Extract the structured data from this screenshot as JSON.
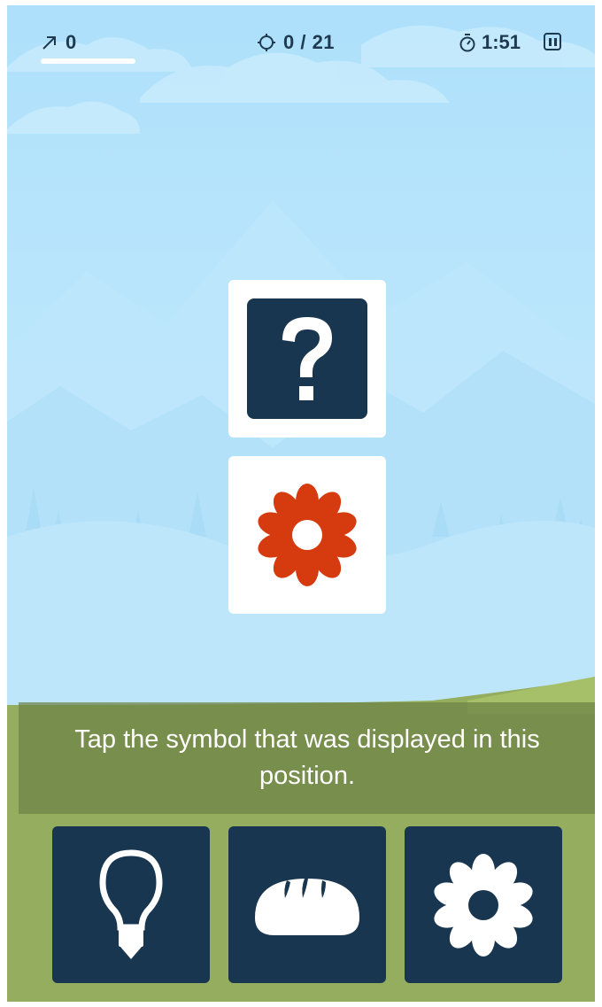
{
  "hud": {
    "score": "0",
    "score_icon": "trend-arrow-icon",
    "progress": "0 / 21",
    "progress_icon": "target-icon",
    "timer": "1:51",
    "timer_icon": "stopwatch-icon",
    "pause_icon": "pause-icon"
  },
  "board": {
    "hidden_card_icon": "question-mark-icon",
    "shown_card_icon": "flower-icon",
    "shown_card_color": "#d63a0f",
    "card_dark_color": "#18364f"
  },
  "instruction": {
    "text": "Tap the symbol that was displayed in this position."
  },
  "choices": [
    {
      "icon": "lightbulb-icon"
    },
    {
      "icon": "bread-icon"
    },
    {
      "icon": "flower-icon"
    }
  ],
  "colors": {
    "sky": "#aee0fb",
    "grass": "#94ad5e",
    "hud_text": "#1f3a50"
  }
}
